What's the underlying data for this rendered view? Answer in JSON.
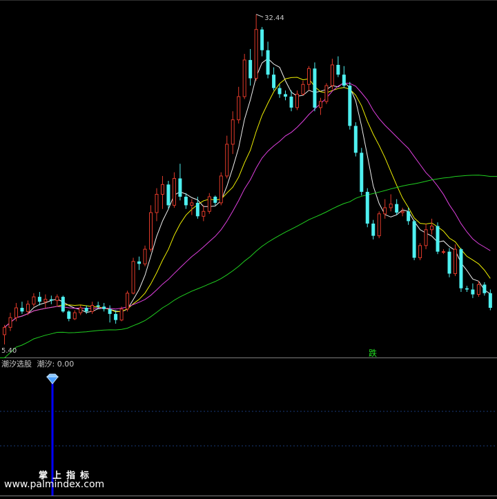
{
  "chart_data": {
    "type": "candlestick",
    "price_range": [
      4.5,
      33.5
    ],
    "high_label": "32.44",
    "low_label": "5.40",
    "signal_label": "跌",
    "candles": [
      [
        6.2,
        7.0,
        5.4,
        6.8
      ],
      [
        6.8,
        8.0,
        6.5,
        7.6
      ],
      [
        7.6,
        8.8,
        7.3,
        8.4
      ],
      [
        8.4,
        8.9,
        7.9,
        8.1
      ],
      [
        8.1,
        9.0,
        7.8,
        8.7
      ],
      [
        8.7,
        9.6,
        8.5,
        9.3
      ],
      [
        9.3,
        9.7,
        8.6,
        8.9
      ],
      [
        8.9,
        9.5,
        8.4,
        9.1
      ],
      [
        9.1,
        9.4,
        8.7,
        9.0
      ],
      [
        9.0,
        9.5,
        8.5,
        9.3
      ],
      [
        9.3,
        9.4,
        8.0,
        8.1
      ],
      [
        8.1,
        8.2,
        7.3,
        7.5
      ],
      [
        7.5,
        8.2,
        7.4,
        8.0
      ],
      [
        8.0,
        8.6,
        7.8,
        8.4
      ],
      [
        8.4,
        8.6,
        7.9,
        8.1
      ],
      [
        8.1,
        8.9,
        7.9,
        8.6
      ],
      [
        8.6,
        8.9,
        8.3,
        8.5
      ],
      [
        8.5,
        8.8,
        8.1,
        8.3
      ],
      [
        8.3,
        8.6,
        7.2,
        7.9
      ],
      [
        7.9,
        8.2,
        7.1,
        7.4
      ],
      [
        7.4,
        8.5,
        7.3,
        8.3
      ],
      [
        8.3,
        9.8,
        8.1,
        9.6
      ],
      [
        9.6,
        12.5,
        9.5,
        12.2
      ],
      [
        12.2,
        12.6,
        11.5,
        12.0
      ],
      [
        12.0,
        13.5,
        11.8,
        13.2
      ],
      [
        13.2,
        16.8,
        13.0,
        16.2
      ],
      [
        16.2,
        18.2,
        15.5,
        17.7
      ],
      [
        17.7,
        19.2,
        16.5,
        18.5
      ],
      [
        18.5,
        18.8,
        16.5,
        16.8
      ],
      [
        16.8,
        19.5,
        16.6,
        19.0
      ],
      [
        19.0,
        20.2,
        17.2,
        17.5
      ],
      [
        17.5,
        17.8,
        16.5,
        16.8
      ],
      [
        16.8,
        17.3,
        16.0,
        17.0
      ],
      [
        17.0,
        17.5,
        15.7,
        15.9
      ],
      [
        15.9,
        16.8,
        15.5,
        16.3
      ],
      [
        16.3,
        17.8,
        16.1,
        17.5
      ],
      [
        17.5,
        17.6,
        16.8,
        17.0
      ],
      [
        17.0,
        19.5,
        16.8,
        19.2
      ],
      [
        19.2,
        22.5,
        19.0,
        21.8
      ],
      [
        21.8,
        24.5,
        21.0,
        23.8
      ],
      [
        23.8,
        26.5,
        23.5,
        25.7
      ],
      [
        25.7,
        29.2,
        25.5,
        28.7
      ],
      [
        28.7,
        29.6,
        26.6,
        27.2
      ],
      [
        27.2,
        32.44,
        27.0,
        31.2
      ],
      [
        31.2,
        31.4,
        29.0,
        29.5
      ],
      [
        29.5,
        30.2,
        27.2,
        27.5
      ],
      [
        27.5,
        28.1,
        26.2,
        26.4
      ],
      [
        26.4,
        26.7,
        25.6,
        25.9
      ],
      [
        25.9,
        26.2,
        25.4,
        25.7
      ],
      [
        25.7,
        26.2,
        24.5,
        24.8
      ],
      [
        24.8,
        26.2,
        24.6,
        25.9
      ],
      [
        25.9,
        27.0,
        25.8,
        26.7
      ],
      [
        26.7,
        28.2,
        26.2,
        28.0
      ],
      [
        28.0,
        28.5,
        24.5,
        24.8
      ],
      [
        24.8,
        25.6,
        24.2,
        25.3
      ],
      [
        25.3,
        26.8,
        25.1,
        26.6
      ],
      [
        26.6,
        28.8,
        26.3,
        28.3
      ],
      [
        28.3,
        29.0,
        27.3,
        27.5
      ],
      [
        27.5,
        28.2,
        26.4,
        26.6
      ],
      [
        26.6,
        26.9,
        23.0,
        23.3
      ],
      [
        23.3,
        23.6,
        20.8,
        21.1
      ],
      [
        21.1,
        21.5,
        17.6,
        17.9
      ],
      [
        17.9,
        18.2,
        15.0,
        15.3
      ],
      [
        15.3,
        15.6,
        14.0,
        14.3
      ],
      [
        14.3,
        16.3,
        14.1,
        16.1
      ],
      [
        16.1,
        17.3,
        15.7,
        16.6
      ],
      [
        16.6,
        17.7,
        16.3,
        16.9
      ],
      [
        16.9,
        17.3,
        16.0,
        16.2
      ],
      [
        16.2,
        16.6,
        15.9,
        16.3
      ],
      [
        16.3,
        16.6,
        15.2,
        15.5
      ],
      [
        15.5,
        15.6,
        12.3,
        12.5
      ],
      [
        12.5,
        13.7,
        12.3,
        13.5
      ],
      [
        13.5,
        15.3,
        13.2,
        14.8
      ],
      [
        14.8,
        15.7,
        14.4,
        15.1
      ],
      [
        15.1,
        15.4,
        12.8,
        13.0
      ],
      [
        13.0,
        13.2,
        12.8,
        13.0
      ],
      [
        13.0,
        13.3,
        10.9,
        11.2
      ],
      [
        11.2,
        13.6,
        11.0,
        13.2
      ],
      [
        13.2,
        13.3,
        9.7,
        10.0
      ],
      [
        10.0,
        10.2,
        9.7,
        9.9
      ],
      [
        9.9,
        10.4,
        9.2,
        9.5
      ],
      [
        9.5,
        10.6,
        9.3,
        10.3
      ],
      [
        10.3,
        10.5,
        9.4,
        9.6
      ],
      [
        9.6,
        9.9,
        8.2,
        8.4
      ]
    ],
    "indicator": {
      "name": "潮汐选股",
      "value_label": "潮汐: 0.00"
    }
  },
  "watermark": {
    "cn_text": "掌上指标",
    "url_text": "www.palmindex.com"
  },
  "colors": {
    "background": "#000000",
    "up": "#e23a2a",
    "down": "#4ef0f0",
    "ma5": "#f0f0f0",
    "ma10": "#f0f000",
    "ma20": "#e040e0",
    "ma60": "#20d020",
    "signal": "#0000ff",
    "grid": "#1a3a7a"
  }
}
